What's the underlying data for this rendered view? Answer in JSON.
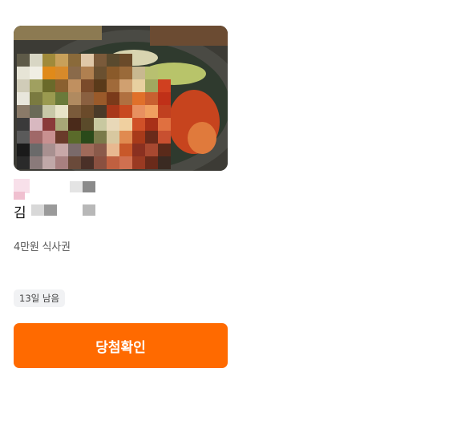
{
  "product": {
    "title": "김",
    "subtitle": "4만원 식사권",
    "days_left": "13일 남음",
    "image_icon": "food-photo-pixelated"
  },
  "cta": {
    "label": "당첨확인",
    "color": "#ff6a00"
  }
}
